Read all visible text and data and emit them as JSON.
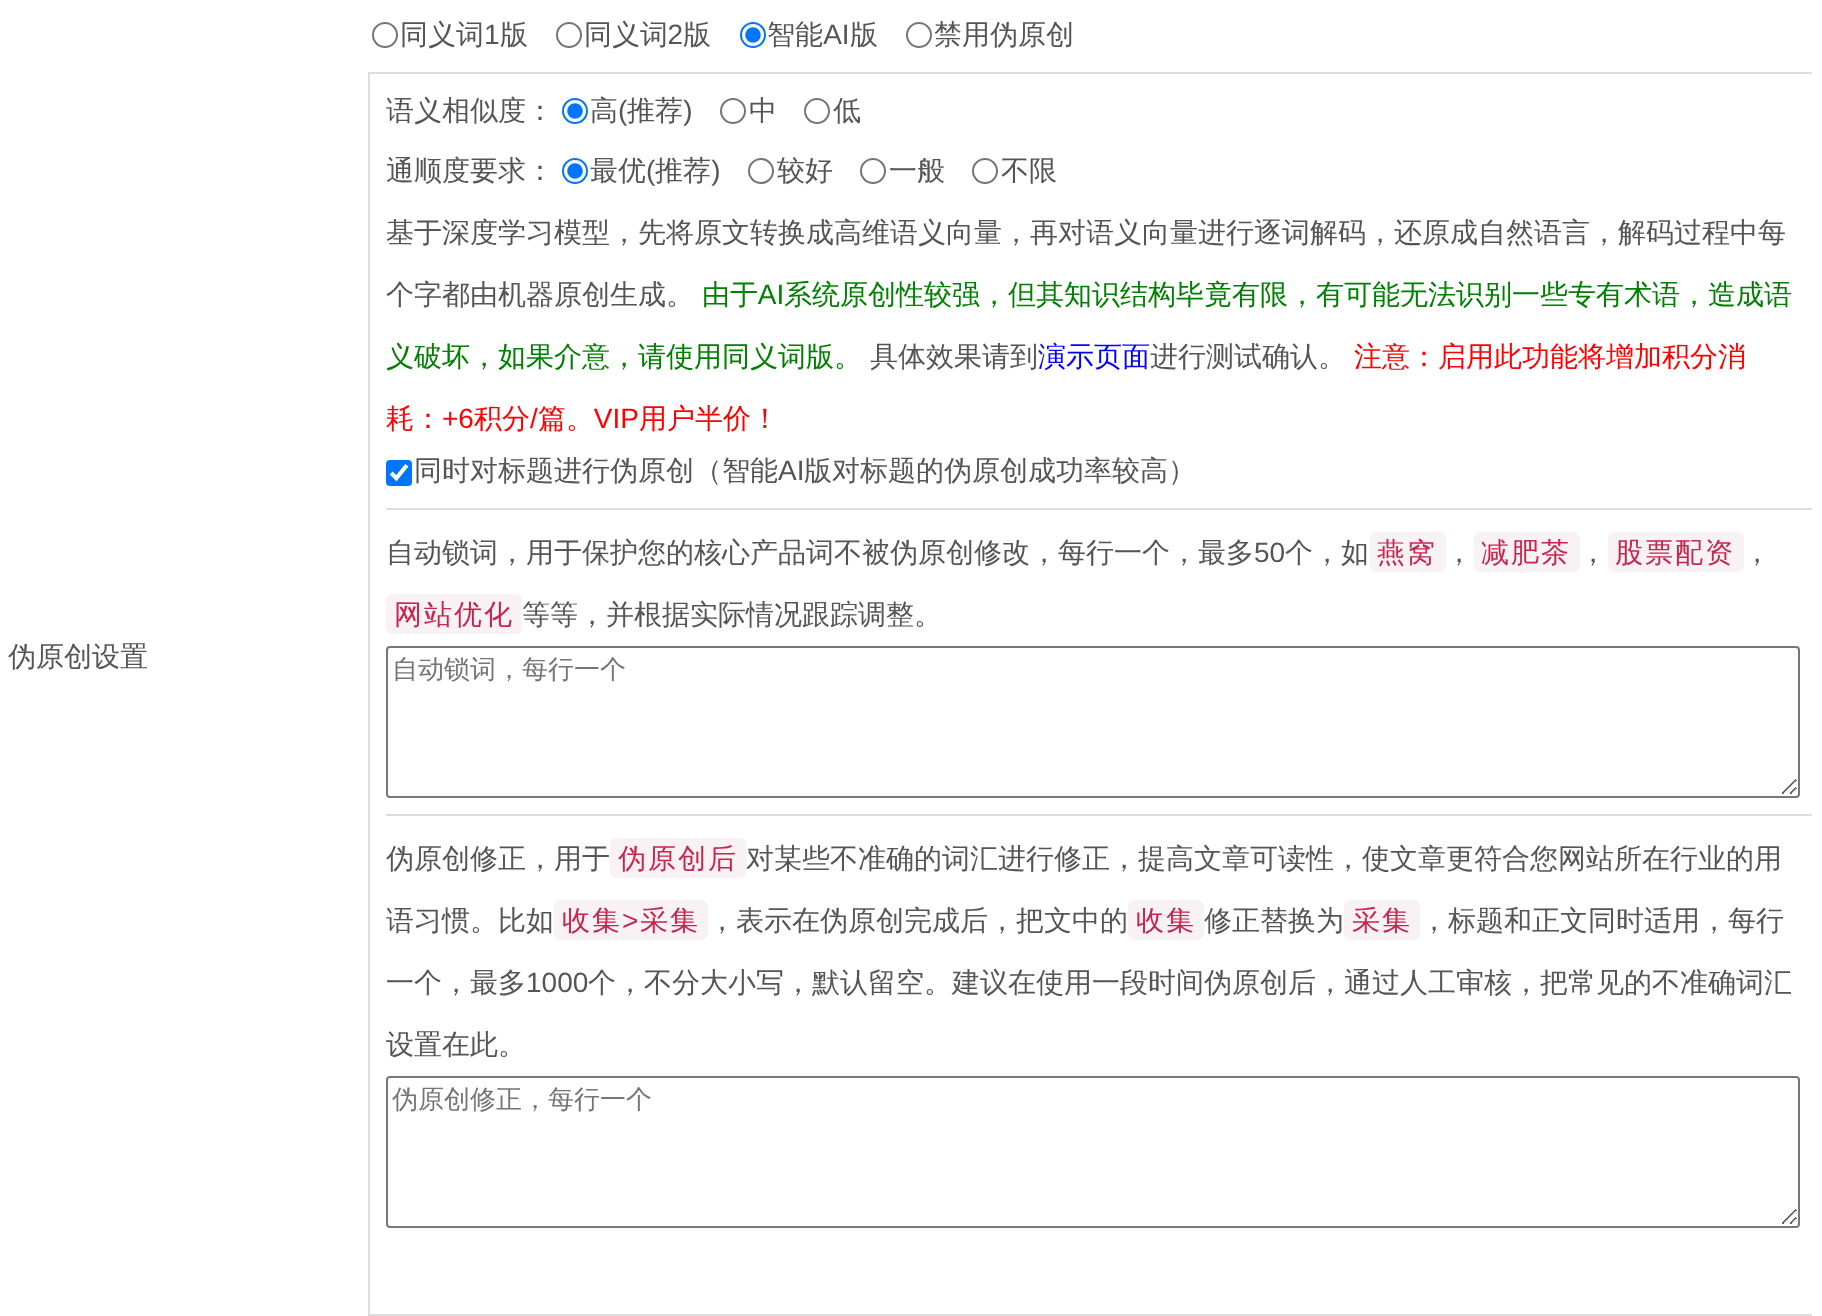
{
  "sidebar": {
    "label": "伪原创设置"
  },
  "modes": [
    {
      "label": "同义词1版",
      "selected": false
    },
    {
      "label": "同义词2版",
      "selected": false
    },
    {
      "label": "智能AI版",
      "selected": true
    },
    {
      "label": "禁用伪原创",
      "selected": false
    }
  ],
  "similarity": {
    "label": "语义相似度：",
    "options": [
      {
        "label": "高(推荐)",
        "selected": true
      },
      {
        "label": "中",
        "selected": false
      },
      {
        "label": "低",
        "selected": false
      }
    ]
  },
  "fluency": {
    "label": "通顺度要求：",
    "options": [
      {
        "label": "最优(推荐)",
        "selected": true
      },
      {
        "label": "较好",
        "selected": false
      },
      {
        "label": "一般",
        "selected": false
      },
      {
        "label": "不限",
        "selected": false
      }
    ]
  },
  "ai_description": [
    {
      "kind": "plain",
      "text": "基于深度学习模型，先将原文转换成高维语义向量，再对语义向量进行逐词解码，还原成自然语言，解码过程中每个字都由机器原创生成。 "
    },
    {
      "kind": "success",
      "text": "由于AI系统原创性较强，但其知识结构毕竟有限，有可能无法识别一些专有术语，造成语义破坏，如果介意，请使用同义词版。"
    },
    {
      "kind": "plain",
      "text": " 具体效果请到"
    },
    {
      "kind": "link",
      "text": "演示页面"
    },
    {
      "kind": "plain",
      "text": "进行测试确认。 "
    },
    {
      "kind": "warning",
      "text": "注意：启用此功能将增加积分消耗：+6积分/篇。VIP用户半价！"
    }
  ],
  "title_option": {
    "label": "同时对标题进行伪原创（智能AI版对标题的伪原创成功率较高）",
    "checked": true
  },
  "lock_words": {
    "description": [
      {
        "kind": "plain",
        "text": "自动锁词，用于保护您的核心产品词不被伪原创修改，每行一个，最多50个，如"
      },
      {
        "kind": "code",
        "text": "燕窝"
      },
      {
        "kind": "plain",
        "text": "，"
      },
      {
        "kind": "code",
        "text": "减肥茶"
      },
      {
        "kind": "plain",
        "text": "，"
      },
      {
        "kind": "code",
        "text": "股票配资"
      },
      {
        "kind": "plain",
        "text": "，"
      },
      {
        "kind": "code",
        "text": "网站优化"
      },
      {
        "kind": "plain",
        "text": "等等，并根据实际情况跟踪调整。"
      }
    ],
    "field": {
      "placeholder": "自动锁词，每行一个"
    }
  },
  "corrections": {
    "description": [
      {
        "kind": "plain",
        "text": "伪原创修正，用于"
      },
      {
        "kind": "code",
        "text": "伪原创后"
      },
      {
        "kind": "plain",
        "text": "对某些不准确的词汇进行修正，提高文章可读性，使文章更符合您网站所在行业的用语习惯。比如"
      },
      {
        "kind": "code",
        "text": "收集>采集"
      },
      {
        "kind": "plain",
        "text": "，表示在伪原创完成后，把文中的"
      },
      {
        "kind": "code",
        "text": "收集"
      },
      {
        "kind": "plain",
        "text": "修正替换为"
      },
      {
        "kind": "code",
        "text": "采集"
      },
      {
        "kind": "plain",
        "text": "，标题和正文同时适用，每行一个，最多1000个，不分大小写，默认留空。建议在使用一段时间伪原创后，通过人工审核，把常见的不准确词汇设置在此。"
      }
    ],
    "field": {
      "placeholder": "伪原创修正，每行一个"
    }
  }
}
